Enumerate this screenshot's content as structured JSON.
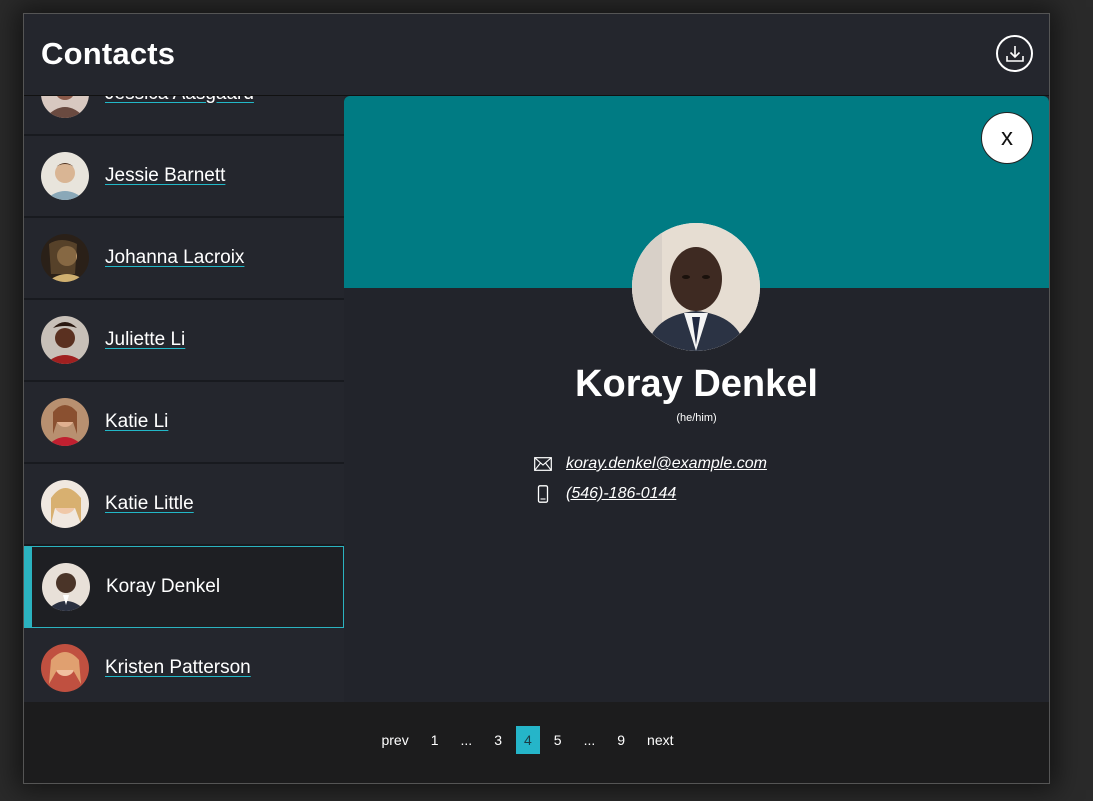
{
  "header": {
    "title": "Contacts",
    "download_icon": "download-icon"
  },
  "contacts": [
    {
      "name": "Jessica Aasgaard",
      "avatar": "#8a5a4a"
    },
    {
      "name": "Jessie Barnett",
      "avatar": "#c9b79a"
    },
    {
      "name": "Johanna Lacroix",
      "avatar": "#5a4630"
    },
    {
      "name": "Juliette Li",
      "avatar": "#6a3a30"
    },
    {
      "name": "Katie Li",
      "avatar": "#a86a4a"
    },
    {
      "name": "Katie Little",
      "avatar": "#d8b890"
    },
    {
      "name": "Koray Denkel",
      "avatar": "#4a3a30"
    },
    {
      "name": "Kristen Patterson",
      "avatar": "#a04a40"
    }
  ],
  "selected": {
    "name": "Koray Denkel",
    "pronouns": "(he/him)",
    "email": "koray.denkel@example.com",
    "phone": "(546)-186-0144",
    "close_label": "x"
  },
  "pagination": {
    "prev": "prev",
    "pages": [
      "1",
      "...",
      "3",
      "4",
      "5",
      "...",
      "9"
    ],
    "current": "4",
    "next": "next"
  },
  "colors": {
    "accent": "#2bb3c0",
    "banner": "#007b83",
    "background": "#22242b"
  }
}
